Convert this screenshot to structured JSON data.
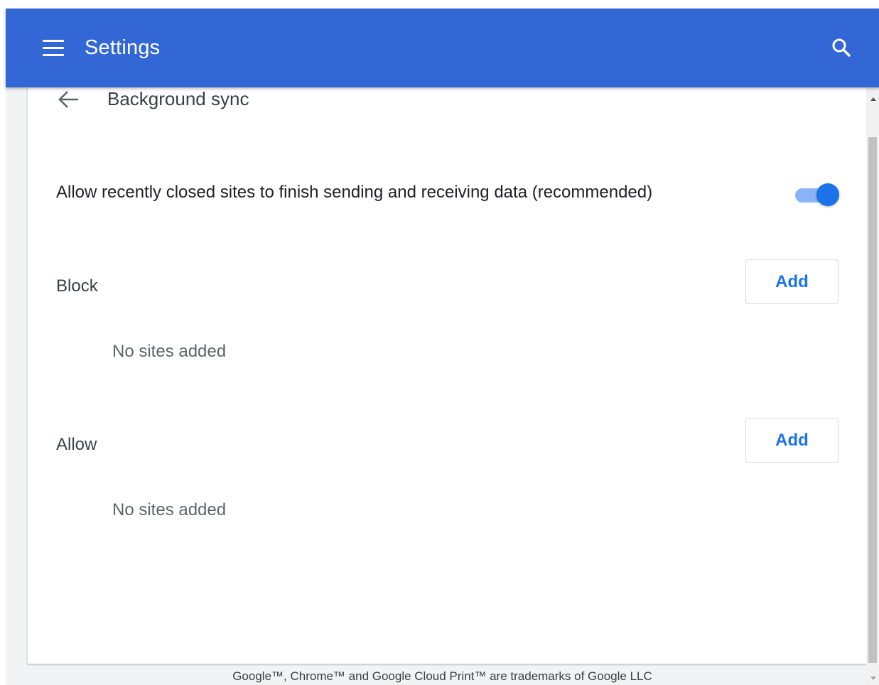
{
  "header": {
    "title": "Settings",
    "menu_icon": "hamburger-menu-icon",
    "search_icon": "search-icon",
    "background_color": "#3367d6"
  },
  "subpage": {
    "title": "Background sync",
    "back_icon": "back-arrow-icon"
  },
  "setting": {
    "label": "Allow recently closed sites to finish sending and receiving data (recommended)",
    "enabled": true,
    "toggle_color": "#1a73e8"
  },
  "block": {
    "label": "Block",
    "add_label": "Add",
    "empty_text": "No sites added"
  },
  "allow": {
    "label": "Allow",
    "add_label": "Add",
    "empty_text": "No sites added"
  },
  "footer": {
    "text": "Google™, Chrome™ and Google Cloud Print™ are trademarks of Google LLC"
  },
  "colors": {
    "accent": "#1a73e8",
    "toolbar": "#3367d6"
  }
}
